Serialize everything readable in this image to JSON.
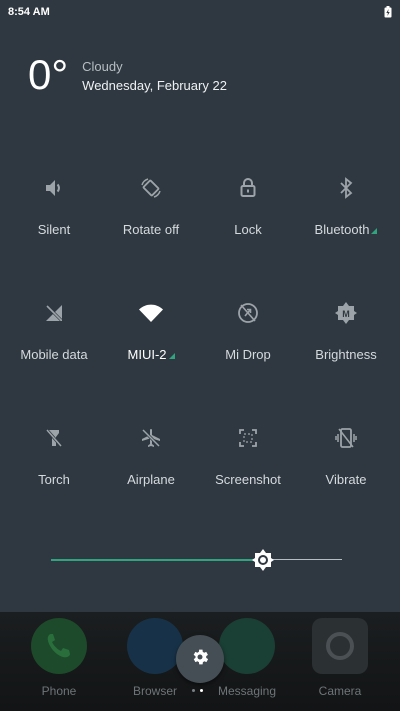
{
  "status_bar": {
    "time": "8:54 AM",
    "battery_icon": "battery-charging-icon"
  },
  "weather": {
    "temperature": "0°",
    "condition": "Cloudy",
    "date": "Wednesday, February 22"
  },
  "tiles": [
    {
      "label": "Silent",
      "icon": "volume-icon",
      "active": false
    },
    {
      "label": "Rotate off",
      "icon": "rotate-icon",
      "active": false
    },
    {
      "label": "Lock",
      "icon": "lock-icon",
      "active": false
    },
    {
      "label": "Bluetooth",
      "icon": "bluetooth-icon",
      "active": false,
      "expandable": true
    },
    {
      "label": "Mobile data",
      "icon": "mobile-data-off-icon",
      "active": false
    },
    {
      "label": "MIUI-2",
      "icon": "wifi-icon",
      "active": true,
      "expandable": true
    },
    {
      "label": "Mi Drop",
      "icon": "mi-drop-icon",
      "active": false
    },
    {
      "label": "Brightness",
      "icon": "auto-brightness-icon",
      "active": false
    },
    {
      "label": "Torch",
      "icon": "torch-icon",
      "active": false
    },
    {
      "label": "Airplane",
      "icon": "airplane-icon",
      "active": false
    },
    {
      "label": "Screenshot",
      "icon": "screenshot-icon",
      "active": false
    },
    {
      "label": "Vibrate",
      "icon": "vibrate-icon",
      "active": false
    }
  ],
  "brightness": {
    "level": 0.73
  },
  "dock": [
    {
      "label": "Phone",
      "icon": "phone-icon"
    },
    {
      "label": "Browser",
      "icon": "browser-icon"
    },
    {
      "label": "Messaging",
      "icon": "messaging-icon"
    },
    {
      "label": "Camera",
      "icon": "camera-icon"
    }
  ],
  "page_indicator": {
    "count": 2,
    "active": 1
  },
  "colors": {
    "panel": "#2f3840",
    "accent": "#2fa47e",
    "text_dim": "#d5dadd"
  }
}
